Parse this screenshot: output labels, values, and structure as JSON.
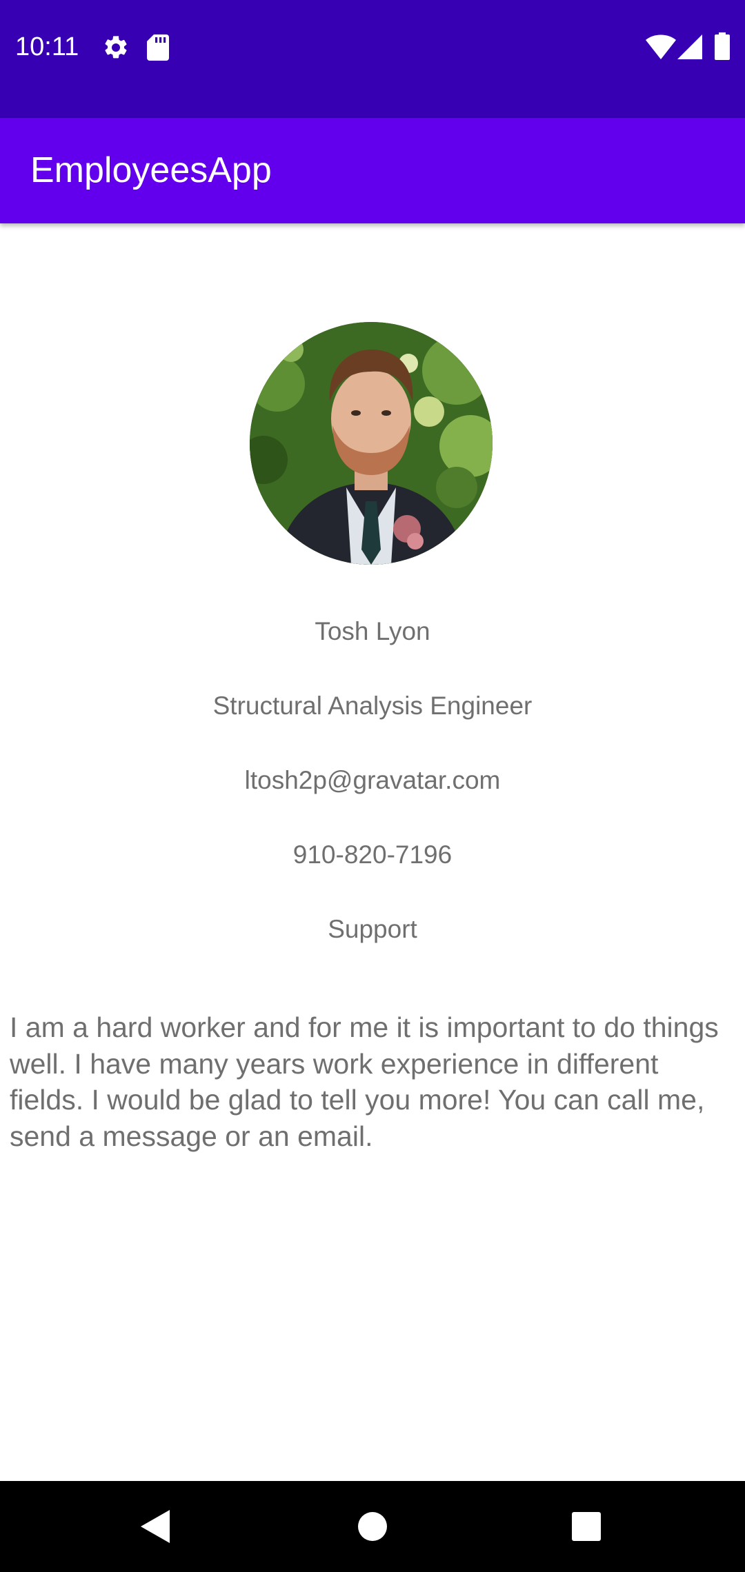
{
  "status_bar": {
    "time": "10:11",
    "icons": [
      "gear-icon",
      "sd-card-icon",
      "wifi-icon",
      "cell-signal-icon",
      "battery-icon"
    ],
    "background": "#3700b3"
  },
  "app_bar": {
    "title": "EmployeesApp",
    "background": "#6200ee"
  },
  "employee": {
    "photo": "employee-photo",
    "name": "Tosh Lyon",
    "title": "Structural Analysis Engineer",
    "email": "ltosh2p@gravatar.com",
    "phone": "910-820-7196",
    "department": "Support",
    "bio": "I am a hard worker and for me it is important to do things well. I have many years work experience in different fields. I would be glad to tell you more! You can call me, send a message or an email."
  },
  "nav_bar": {
    "buttons": [
      "back-icon",
      "home-icon",
      "recents-icon"
    ]
  },
  "colors": {
    "text": "#6f6f6f",
    "background": "#ffffff"
  }
}
